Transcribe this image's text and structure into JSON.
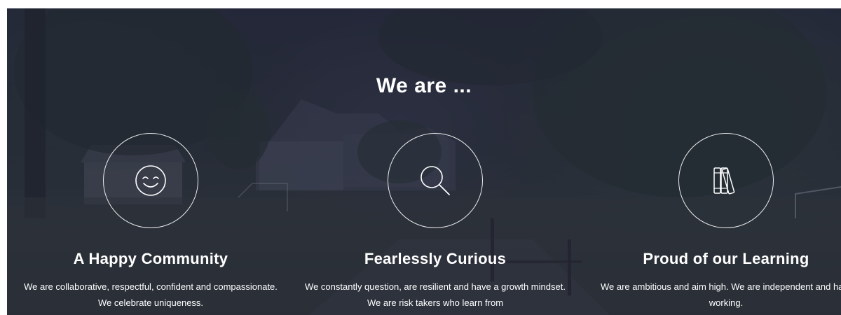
{
  "section": {
    "heading": "We are ..."
  },
  "features": [
    {
      "icon": "smiley-face-icon",
      "title": "A Happy Community",
      "description": "We are collaborative, respectful, confident and compassionate. We celebrate uniqueness."
    },
    {
      "icon": "magnifying-glass-icon",
      "title": "Fearlessly Curious",
      "description": "We constantly question, are resilient and have a growth mindset. We are risk takers who learn from"
    },
    {
      "icon": "books-icon",
      "title": "Proud of our Learning",
      "description": "We are ambitious and aim high. We are independent and hard working."
    }
  ]
}
